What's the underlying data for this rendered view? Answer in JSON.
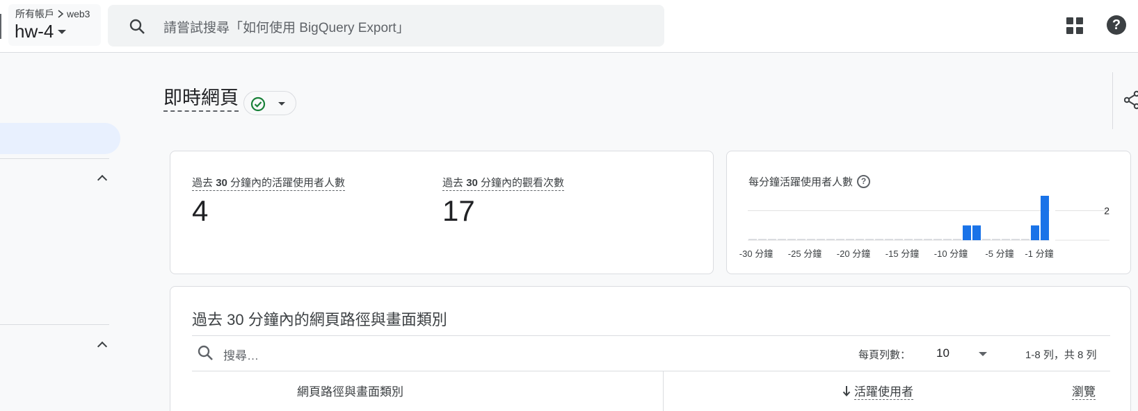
{
  "header": {
    "breadcrumb_root": "所有帳戶",
    "breadcrumb_account": "web3",
    "property": "hw-4",
    "search_placeholder": "請嘗試搜尋「如何使用 BigQuery Export」"
  },
  "page": {
    "title": "即時網頁"
  },
  "metrics": [
    {
      "label_prefix": "過去",
      "label_num": "30",
      "label_suffix": "分鐘內的活躍使用者人數",
      "value": "4"
    },
    {
      "label_prefix": "過去",
      "label_num": "30",
      "label_suffix": "分鐘內的觀看次數",
      "value": "17"
    }
  ],
  "chart_data": {
    "type": "bar",
    "title": "每分鐘活躍使用者人數",
    "x_tick_labels": [
      "-30 分鐘",
      "-25 分鐘",
      "-20 分鐘",
      "-15 分鐘",
      "-10 分鐘",
      "-5 分鐘",
      "-1 分鐘"
    ],
    "values": [
      0,
      0,
      0,
      0,
      0,
      0,
      0,
      0,
      0,
      0,
      0,
      0,
      0,
      0,
      0,
      0,
      0,
      0,
      0,
      0,
      0,
      0,
      1,
      1,
      0,
      0,
      0,
      0,
      0,
      1,
      3
    ],
    "y_max_label": "2",
    "ylim": [
      0,
      3
    ],
    "bar_color": "#1a73e8",
    "grid": true
  },
  "table": {
    "title": "過去 30 分鐘內的網頁路徑與畫面類別",
    "search_placeholder": "搜尋…",
    "rows_per_page_label": "每頁列數：",
    "rows_per_page_value": "10",
    "range_text": "1-8 列，共 8 列",
    "columns": [
      "網頁路徑與畫面類別",
      "活躍使用者",
      "瀏覽"
    ]
  },
  "colors": {
    "accent": "#1a73e8",
    "status_ok": "#188038"
  }
}
